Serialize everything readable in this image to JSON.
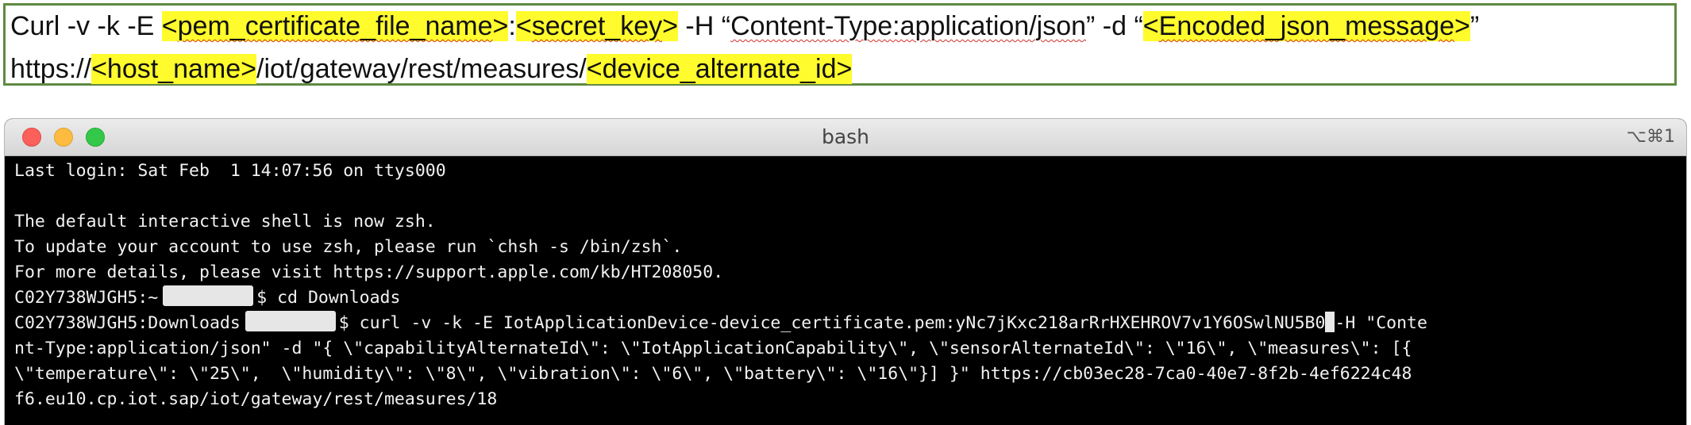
{
  "document": {
    "line1": [
      {
        "text": "Curl -v -k -E ",
        "hl": false
      },
      {
        "text": "<",
        "hl": true
      },
      {
        "text": "pem_certificate_file_name",
        "hl": true,
        "sq": true
      },
      {
        "text": ">",
        "hl": true
      },
      {
        "text": ":",
        "hl": false
      },
      {
        "text": "<",
        "hl": true
      },
      {
        "text": "secret_key",
        "hl": true,
        "sq": true
      },
      {
        "text": ">",
        "hl": true
      },
      {
        "text": " -H “",
        "hl": false
      },
      {
        "text": "Content-Type:application/json",
        "hl": false,
        "sq": true
      },
      {
        "text": "” -d “",
        "hl": false
      },
      {
        "text": "<",
        "hl": true
      },
      {
        "text": "Encoded_json_message",
        "hl": true,
        "sq": true
      },
      {
        "text": ">",
        "hl": true
      },
      {
        "text": "”",
        "hl": false
      }
    ],
    "line2": [
      {
        "text": "https://",
        "hl": false
      },
      {
        "text": "<host_name>",
        "hl": true
      },
      {
        "text": "/iot/gateway/rest/measures/",
        "hl": false
      },
      {
        "text": "<device_alternate_id>",
        "hl": true
      }
    ],
    "highlight_color": "#fffb2c",
    "border_color": "#5f8a42"
  },
  "terminal": {
    "title": "bash",
    "shortcut": "⌥⌘1",
    "lines": {
      "last_login": "Last login: Sat Feb  1 14:07:56 on ttys000",
      "blank": "",
      "default_shell": "The default interactive shell is now zsh.",
      "update_account": "To update your account to use zsh, please run `chsh -s /bin/zsh`.",
      "more_details": "For more details, please visit https://support.apple.com/kb/HT208050.",
      "prompt1_host": "C02Y738WJGH5:~",
      "prompt1_cmd": "$ cd Downloads",
      "prompt2_host": "C02Y738WJGH5:Downloads",
      "prompt2_cmd": "$ curl -v -k -E IotApplicationDevice-device_certificate.pem:yNc7jKxc218arRrHXEHROV7v1Y6OSwlNU5B0",
      "prompt2_cmd_after_cursor": "-H \"Conte",
      "wrap1": "nt-Type:application/json\" -d \"{ \\\"capabilityAlternateId\\\": \\\"IotApplicationCapability\\\", \\\"sensorAlternateId\\\": \\\"16\\\", \\\"measures\\\": [{",
      "wrap2": "\\\"temperature\\\": \\\"25\\\",  \\\"humidity\\\": \\\"8\\\", \\\"vibration\\\": \\\"6\\\", \\\"battery\\\": \\\"16\\\"}] }\" https://cb03ec28-7ca0-40e7-8f2b-4ef6224c48",
      "wrap3": "f6.eu10.cp.iot.sap/iot/gateway/rest/measures/18"
    }
  }
}
